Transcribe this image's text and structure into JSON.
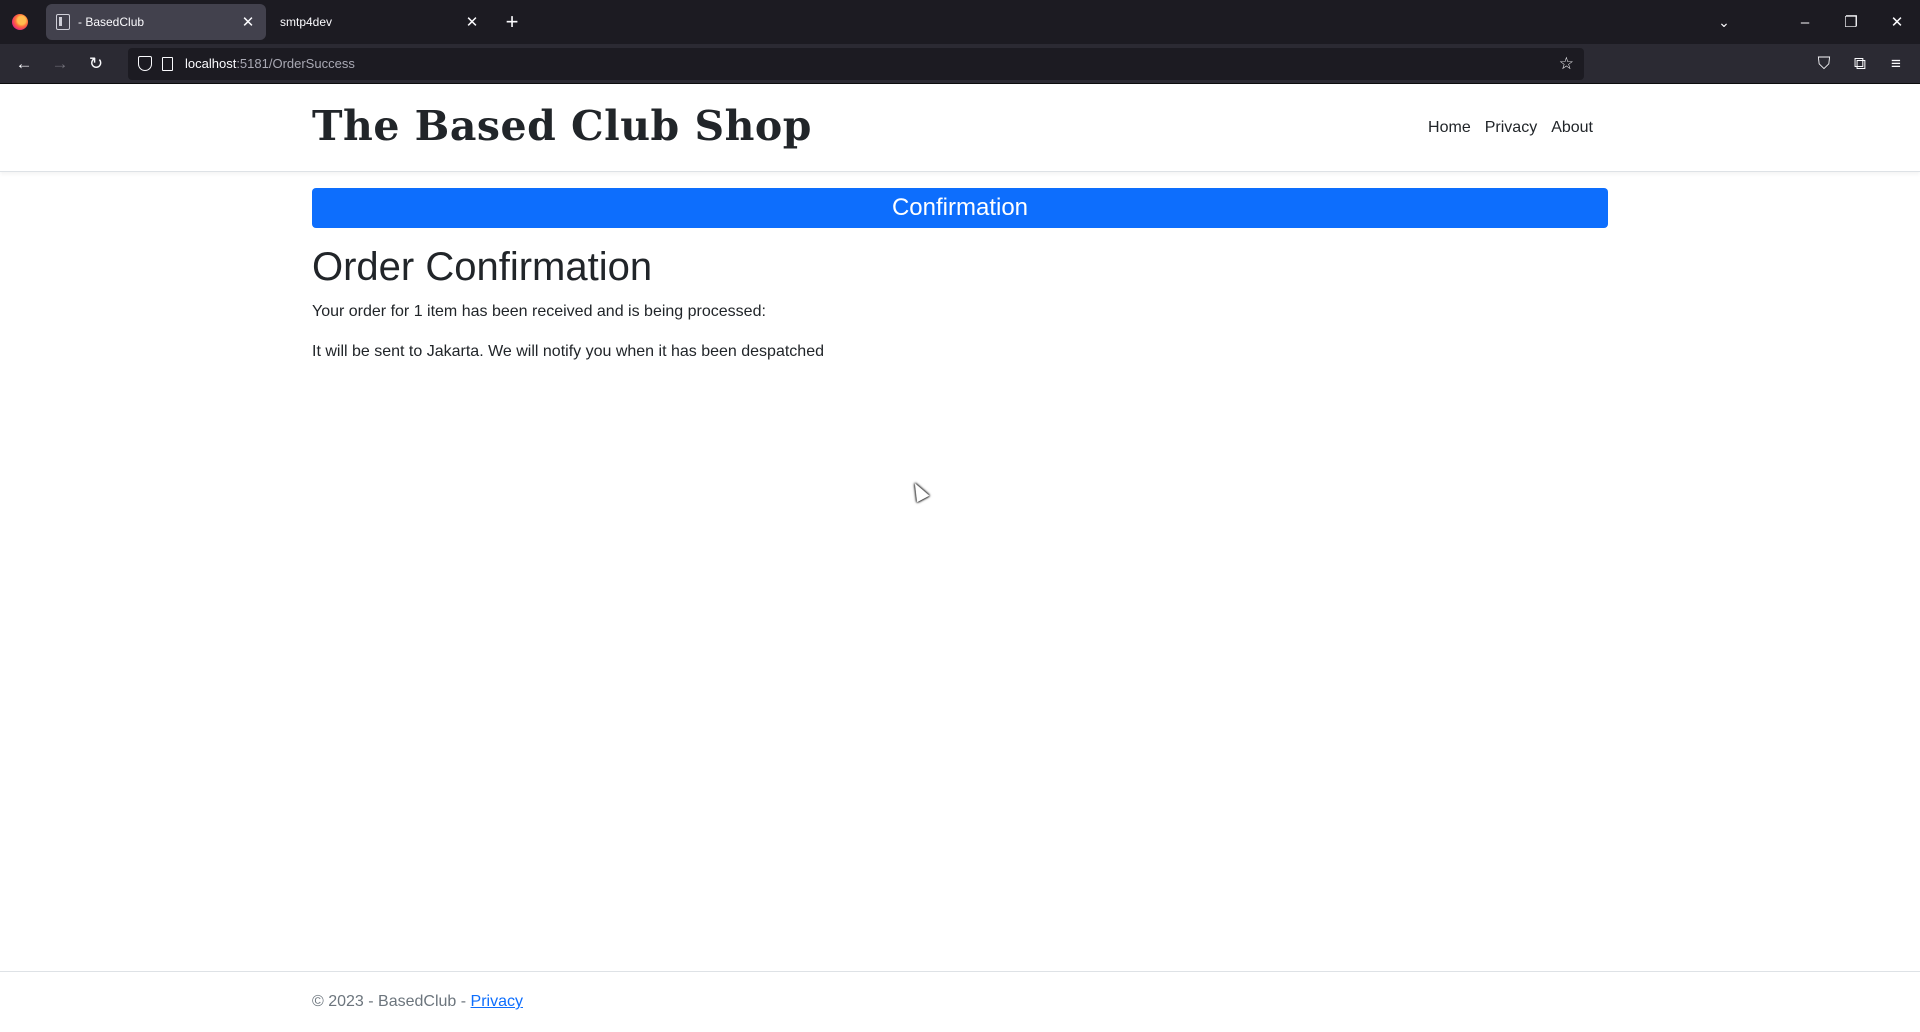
{
  "browser": {
    "tabs": [
      {
        "title": "- BasedClub",
        "active": true
      },
      {
        "title": "smtp4dev",
        "active": false
      }
    ],
    "url_host": "localhost",
    "url_path": ":5181/OrderSuccess",
    "icons": {
      "new_tab": "+",
      "tab_list": "⌄",
      "minimize": "–",
      "restore": "❐",
      "close_window": "✕",
      "back": "←",
      "forward": "→",
      "reload": "↻",
      "bookmark_star": "☆",
      "pocket": "⛉",
      "extensions": "⧉",
      "menu": "≡",
      "tab_close": "✕"
    }
  },
  "site": {
    "brand": "The Based Club Shop",
    "nav": [
      "Home",
      "Privacy",
      "About"
    ],
    "banner": "Confirmation",
    "heading": "Order Confirmation",
    "line1": "Your order for 1 item has been received and is being processed:",
    "line2": "It will be sent to Jakarta. We will notify you when it has been despatched",
    "footer_text": "© 2023 - BasedClub - ",
    "footer_link": "Privacy",
    "accent_color": "#0d6efd"
  }
}
